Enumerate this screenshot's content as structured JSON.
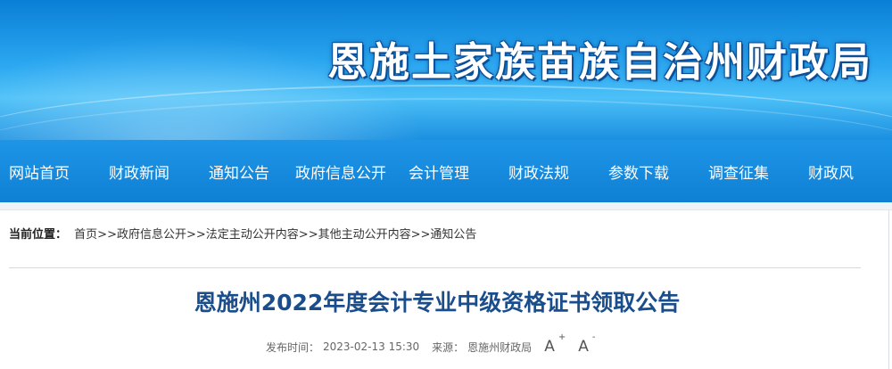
{
  "header": {
    "title": "恩施土家族苗族自治州财政局"
  },
  "nav": {
    "items": [
      {
        "label": "网站首页"
      },
      {
        "label": "财政新闻"
      },
      {
        "label": "通知公告"
      },
      {
        "label": "政府信息公开"
      },
      {
        "label": "会计管理"
      },
      {
        "label": "财政法规"
      },
      {
        "label": "参数下载"
      },
      {
        "label": "调查征集"
      },
      {
        "label": "财政风"
      }
    ]
  },
  "breadcrumb": {
    "label": "当前位置：",
    "separator": ">>",
    "items": [
      "首页",
      "政府信息公开",
      "法定主动公开内容",
      "其他主动公开内容",
      "通知公告"
    ]
  },
  "article": {
    "title": "恩施州2022年度会计专业中级资格证书领取公告",
    "publish_label": "发布时间：",
    "publish_time": "2023-02-13 15:30",
    "source_label": "来源：",
    "source": "恩施州财政局",
    "font_increase": "A",
    "font_increase_mark": "+",
    "font_decrease": "A",
    "font_decrease_mark": "-"
  },
  "colors": {
    "banner_blue": "#2aa6f0",
    "nav_blue": "#1288d9",
    "title_blue": "#1a4d8c"
  }
}
